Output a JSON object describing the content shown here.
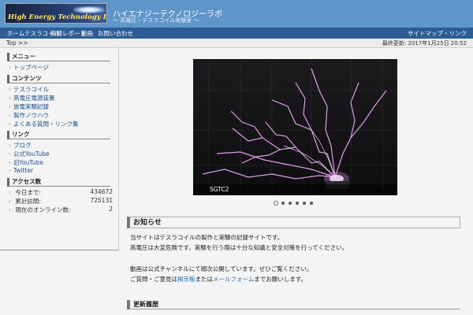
{
  "header": {
    "logo_text": "High Energy Technology Lab",
    "site_title": "ハイエナジーテクノロジーラボ",
    "site_subtitle": "～ 高電圧・テスラコイル実験室 ～"
  },
  "nav": {
    "items": [
      "ホーム",
      "テスラコイル",
      "実験レポート",
      "動画",
      "お問い合わせ"
    ],
    "right": "サイトマップ・リンク"
  },
  "breadcrumb": "Top >>",
  "updated": "最終更新: 2017年1月25日 20:52",
  "sidebar": {
    "menu": {
      "title": "メニュー",
      "items": [
        "トップページ"
      ]
    },
    "content": {
      "title": "コンテンツ",
      "items": [
        "テスラコイル",
        "高電圧電源装置",
        "放電実験記録",
        "製作ノウハウ",
        "よくある質問・リンク集"
      ]
    },
    "links": {
      "title": "リンク",
      "items": [
        "ブログ",
        "公式YouTube",
        "旧YouTube",
        "Twitter"
      ]
    },
    "stats": {
      "title": "アクセス数",
      "rows": [
        {
          "label": "今日まで:",
          "value": "434672"
        },
        {
          "label": "累計訪問:",
          "value": "725131"
        },
        {
          "label": "現在のオンライン数:",
          "value": "2"
        }
      ]
    }
  },
  "slideshow": {
    "caption": "SGTC2",
    "dot_count": 6,
    "active_index": 0
  },
  "section1": {
    "title": "お知らせ",
    "lines": [
      "当サイトはテスラコイルの製作と実験の記録サイトです。",
      "高電圧は大変危険です。実験を行う際は十分な知識と安全対策を行ってください。",
      "動画は公式チャンネルにて順次公開しています。ぜひご覧ください。"
    ],
    "line4_before": "ご質問・ご意見は",
    "line4_link1": "掲示板",
    "line4_mid": "または",
    "line4_link2": "メールフォーム",
    "line4_after": "までお願いします。"
  },
  "section2": {
    "title": "更新履歴"
  }
}
